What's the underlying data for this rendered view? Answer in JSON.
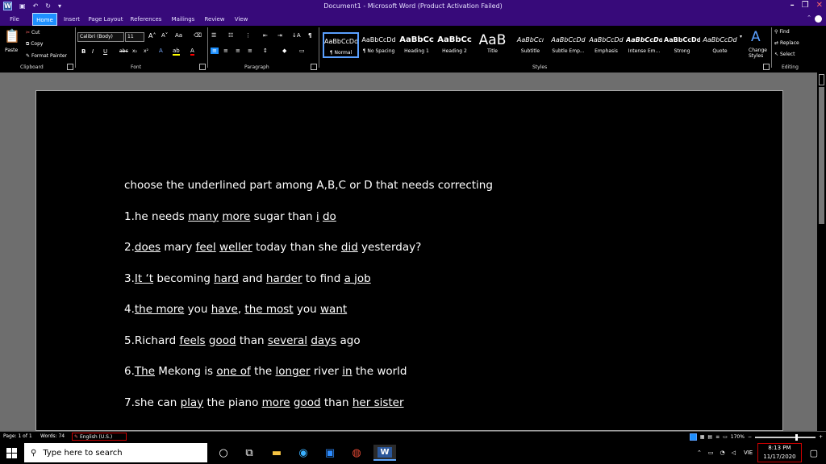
{
  "window": {
    "title": "Document1  -  Microsoft Word (Product Activation Failed)"
  },
  "tabs": [
    "File",
    "Home",
    "Insert",
    "Page Layout",
    "References",
    "Mailings",
    "Review",
    "View"
  ],
  "clipboard": {
    "paste": "Paste",
    "cut": "Cut",
    "copy": "Copy",
    "format_painter": "Format Painter",
    "label": "Clipboard"
  },
  "font": {
    "name": "Calibri (Body)",
    "size": "11",
    "label": "Font"
  },
  "paragraph": {
    "label": "Paragraph"
  },
  "styles": {
    "label": "Styles",
    "change": "Change Styles",
    "items": [
      {
        "sample": "AaBbCcDd",
        "name": "¶ Normal"
      },
      {
        "sample": "AaBbCcDd",
        "name": "¶ No Spacing"
      },
      {
        "sample": "AaBbCc",
        "name": "Heading 1"
      },
      {
        "sample": "AaBbCc",
        "name": "Heading 2"
      },
      {
        "sample": "AaB",
        "name": "Title"
      },
      {
        "sample": "AaBbCcı",
        "name": "Subtitle"
      },
      {
        "sample": "AaBbCcDd",
        "name": "Subtle Emp..."
      },
      {
        "sample": "AaBbCcDd",
        "name": "Emphasis"
      },
      {
        "sample": "AaBbCcDd",
        "name": "Intense Em..."
      },
      {
        "sample": "AaBbCcDd",
        "name": "Strong"
      },
      {
        "sample": "AaBbCcDd",
        "name": "Quote"
      }
    ]
  },
  "editing": {
    "find": "Find",
    "replace": "Replace",
    "select": "Select",
    "label": "Editing"
  },
  "doc": {
    "lines": [
      [
        {
          "t": "choose the underlined part among A,B,C or D that needs correcting"
        }
      ],
      [
        {
          "t": "1.he needs "
        },
        {
          "t": "many",
          "u": true
        },
        {
          "t": " "
        },
        {
          "t": "more",
          "u": true
        },
        {
          "t": " sugar than "
        },
        {
          "t": "i",
          "u": true
        },
        {
          "t": " "
        },
        {
          "t": "do",
          "u": true
        }
      ],
      [
        {
          "t": "2."
        },
        {
          "t": "does",
          "u": true
        },
        {
          "t": " mary "
        },
        {
          "t": "feel",
          "u": true
        },
        {
          "t": " "
        },
        {
          "t": "weller",
          "u": true
        },
        {
          "t": " today than she "
        },
        {
          "t": "did",
          "u": true
        },
        {
          "t": " yesterday?"
        }
      ],
      [
        {
          "t": "3."
        },
        {
          "t": "It ‘t",
          "u": true
        },
        {
          "t": " becoming "
        },
        {
          "t": "hard",
          "u": true
        },
        {
          "t": " and "
        },
        {
          "t": "harder",
          "u": true
        },
        {
          "t": " to find "
        },
        {
          "t": "a job",
          "u": true
        }
      ],
      [
        {
          "t": "4."
        },
        {
          "t": "the more",
          "u": true
        },
        {
          "t": " you "
        },
        {
          "t": "have",
          "u": true
        },
        {
          "t": ", "
        },
        {
          "t": "the most",
          "u": true
        },
        {
          "t": " you "
        },
        {
          "t": "want",
          "u": true
        }
      ],
      [
        {
          "t": "5.Richard "
        },
        {
          "t": "feels",
          "u": true
        },
        {
          "t": " "
        },
        {
          "t": "good",
          "u": true
        },
        {
          "t": " than "
        },
        {
          "t": "several",
          "u": true
        },
        {
          "t": " "
        },
        {
          "t": "days",
          "u": true
        },
        {
          "t": " ago"
        }
      ],
      [
        {
          "t": "6."
        },
        {
          "t": "The",
          "u": true
        },
        {
          "t": " Mekong is "
        },
        {
          "t": "one of",
          "u": true
        },
        {
          "t": " the "
        },
        {
          "t": "longer",
          "u": true
        },
        {
          "t": " river "
        },
        {
          "t": "in",
          "u": true
        },
        {
          "t": " the world"
        }
      ],
      [
        {
          "t": "7.she can "
        },
        {
          "t": "play",
          "u": true
        },
        {
          "t": " the piano "
        },
        {
          "t": "more",
          "u": true
        },
        {
          "t": " "
        },
        {
          "t": "good",
          "u": true
        },
        {
          "t": " than "
        },
        {
          "t": "her sister",
          "u": true
        }
      ]
    ]
  },
  "status": {
    "page": "Page: 1 of 1",
    "words": "Words: 74",
    "language": "English (U.S.)",
    "zoom": "170%"
  },
  "taskbar": {
    "search_placeholder": "Type here to search",
    "language": "VIE",
    "time": "8:13 PM",
    "date": "11/17/2020"
  }
}
